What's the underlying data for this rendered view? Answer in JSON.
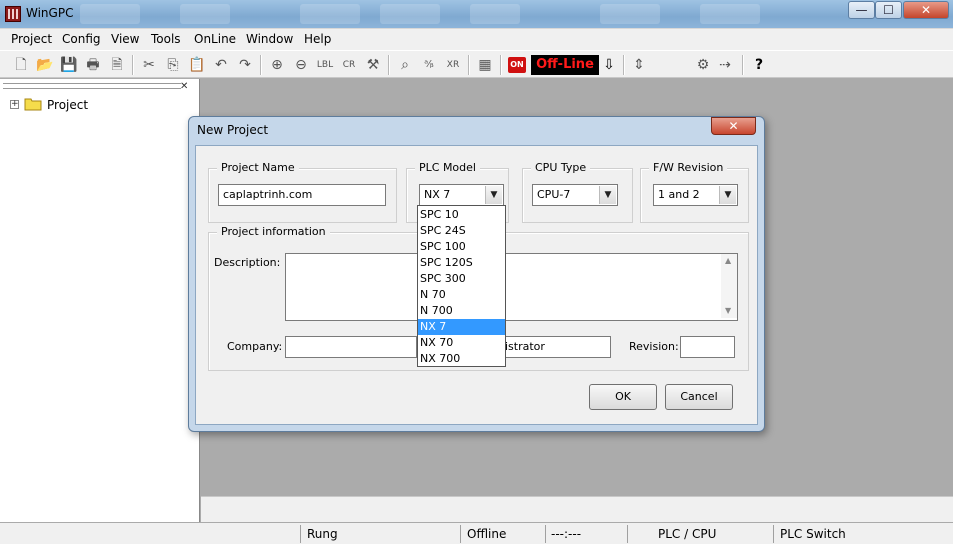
{
  "window": {
    "title": "WinGPC",
    "controls": [
      "—",
      "☐",
      "✕"
    ]
  },
  "menu": [
    "Project",
    "Config",
    "View",
    "Tools",
    "OnLine",
    "Window",
    "Help"
  ],
  "toolbar": {
    "on_label": "ON",
    "status_label": "Off-Line"
  },
  "tree": {
    "root_label": "Project",
    "expander": "+"
  },
  "dialog": {
    "title": "New Project",
    "close_glyph": "✕",
    "project_name": {
      "label": "Project Name",
      "value": "caplaptrinh.com"
    },
    "plc_model": {
      "label": "PLC Model",
      "value": "NX 7"
    },
    "cpu_type": {
      "label": "CPU Type",
      "value": "CPU-7"
    },
    "fw_revision": {
      "label": "F/W Revision",
      "value": "1 and 2"
    },
    "project_info": {
      "label": "Project information",
      "description_label": "Description:",
      "company_label": "Company:",
      "author_value": "nistrator",
      "revision_label": "Revision:"
    },
    "ok_label": "OK",
    "cancel_label": "Cancel"
  },
  "plc_model_options": [
    "SPC 10",
    "SPC 24S",
    "SPC 100",
    "SPC 120S",
    "SPC 300",
    "N 70",
    "N 700",
    "NX 7",
    "NX 70",
    "NX 700"
  ],
  "plc_model_selected": "NX 7",
  "statusbar": {
    "rung": "Rung",
    "mode": "Offline",
    "time": "---:---",
    "plc_cpu": "PLC  /  CPU",
    "plc_switch": "PLC Switch"
  },
  "colors": {
    "selection": "#3399ff",
    "offline_bg": "#000000",
    "offline_text": "#ff1a1a",
    "on_button": "#d01010"
  }
}
